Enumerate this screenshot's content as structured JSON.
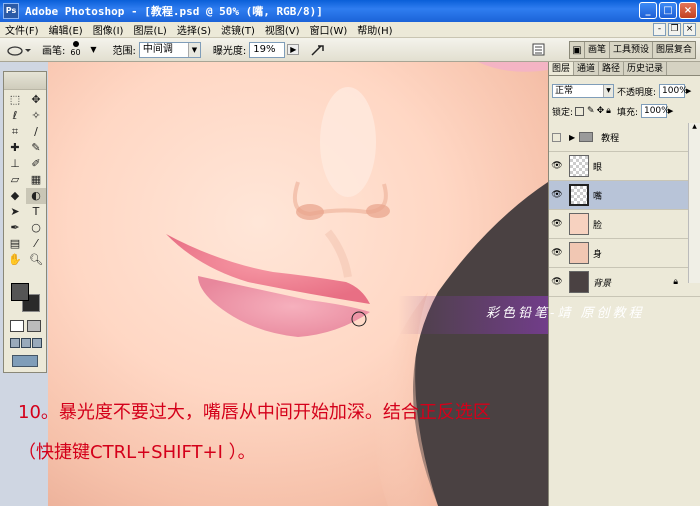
{
  "window": {
    "app_name": "Adobe Photoshop",
    "title": "Adobe Photoshop - [教程.psd @ 50% (嘴, RGB/8)]",
    "app_icon_text": "Ps",
    "buttons": {
      "minimize": "_",
      "maximize": "□",
      "close": "×"
    }
  },
  "menu": {
    "items": [
      "文件(F)",
      "编辑(E)",
      "图像(I)",
      "图层(L)",
      "选择(S)",
      "滤镜(T)",
      "视图(V)",
      "窗口(W)",
      "帮助(H)"
    ],
    "doc_buttons": {
      "minimize": "-",
      "restore": "❐",
      "close": "×"
    }
  },
  "options": {
    "brush_label": "画笔:",
    "brush_size": "60",
    "range_label": "范围:",
    "range_value": "中间调",
    "exposure_label": "曝光度:",
    "exposure_value": "19%",
    "palette_tabs": [
      "画笔",
      "工具预设",
      "图层复合"
    ]
  },
  "layers_panel": {
    "tabs": [
      "图层",
      "通道",
      "路径",
      "历史记录"
    ],
    "blend_mode": "正常",
    "opacity_label": "不透明度:",
    "opacity_value": "100%",
    "lock_label": "锁定:",
    "fill_label": "填充:",
    "fill_value": "100%",
    "layers": [
      {
        "name": "教程",
        "type": "group",
        "visible": false,
        "selected": false
      },
      {
        "name": "眼",
        "type": "layer",
        "visible": true,
        "selected": false
      },
      {
        "name": "嘴",
        "type": "layer",
        "visible": true,
        "selected": true
      },
      {
        "name": "脸",
        "type": "layer",
        "visible": true,
        "selected": false
      },
      {
        "name": "身",
        "type": "layer",
        "visible": true,
        "selected": false
      },
      {
        "name": "背景",
        "type": "background",
        "visible": true,
        "selected": false,
        "locked": true
      }
    ]
  },
  "overlay": {
    "watermark": "彩色铅笔-靖 原创教程",
    "caption_line1": "10。暴光度不要过大，嘴唇从中间开始加深。结合正反选区",
    "caption_line2": "（快捷键CTRL+SHIFT+I ）。"
  },
  "colors": {
    "titlebar": "#1b63d8",
    "caption": "#d4001a",
    "selected_layer": "#b8c4d8",
    "foreground": "#555555",
    "background": "#2a2a2a"
  }
}
